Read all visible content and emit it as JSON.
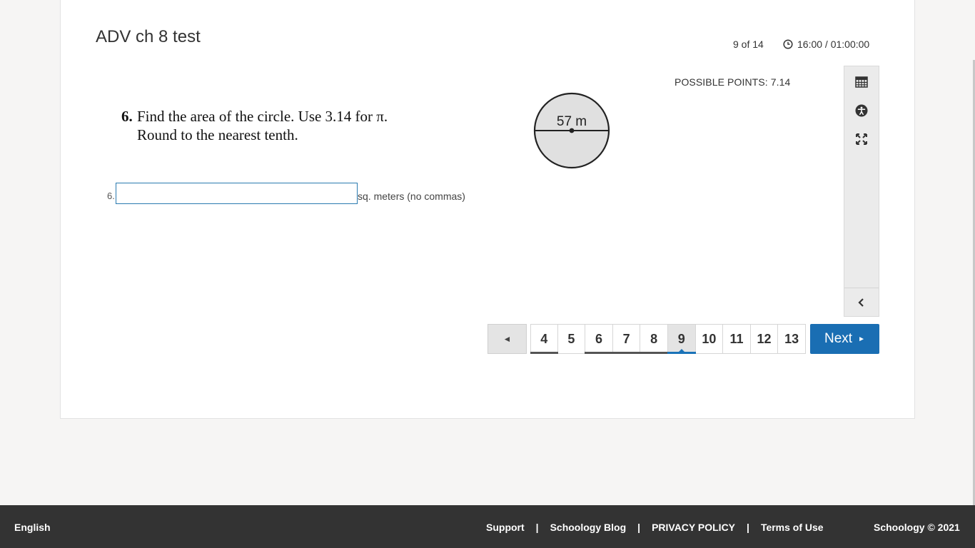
{
  "test": {
    "title": "ADV ch 8 test",
    "progress": "9 of 14",
    "timer": "16:00 / 01:00:00"
  },
  "question": {
    "possible_points": "POSSIBLE POINTS: 7.14",
    "number": "6.",
    "line1": "Find the area of the circle. Use 3.14 for π.",
    "line2": "Round to the nearest tenth.",
    "figure_label": "57 m"
  },
  "answer": {
    "number": "6.",
    "value": "",
    "unit": "sq. meters (no commas)"
  },
  "tools": {
    "icons": [
      "calculator-icon",
      "accessibility-icon",
      "fullscreen-icon",
      "collapse-chevron-icon"
    ]
  },
  "pagination": {
    "prev_label": "◄",
    "pages": [
      "4",
      "5",
      "6",
      "7",
      "8",
      "9",
      "10",
      "11",
      "12",
      "13"
    ],
    "answered": [
      "4",
      "6",
      "7",
      "8"
    ],
    "current": "9",
    "next_label": "Next"
  },
  "footer": {
    "language": "English",
    "support": "Support",
    "blog": "Schoology Blog",
    "privacy": "PRIVACY POLICY",
    "terms": "Terms of Use",
    "separator": "|",
    "copyright": "Schoology © 2021"
  },
  "colors": {
    "primary": "#1a6eb3",
    "footer_bg": "#333333",
    "input_border": "#2a7ab0"
  }
}
